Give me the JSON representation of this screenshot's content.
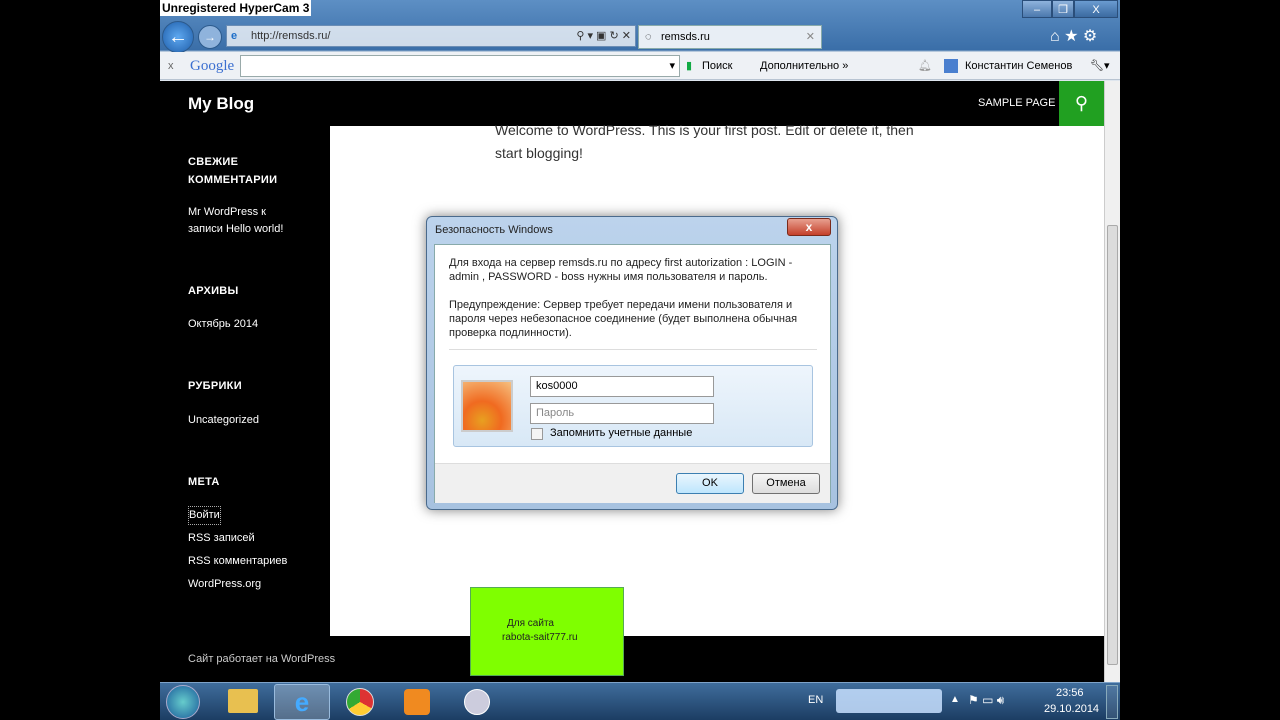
{
  "recorder_watermark": "Unregistered HyperCam 3",
  "browser": {
    "address": "http://remsds.ru/",
    "tab_title": "remsds.ru",
    "window_buttons": [
      "–",
      "❐",
      "X"
    ],
    "google_toolbar": {
      "logo": "Google",
      "search_value": "",
      "search_label": "Поиск",
      "more_label": "Дополнительно »",
      "user": "Константин Семенов"
    }
  },
  "site": {
    "title": "My Blog",
    "nav": [
      "SAMPLE PAGE"
    ],
    "search_color": "#21a021",
    "post_text_1": "Welcome to WordPress. This is your first post. Edit or delete it, then",
    "post_text_2": "start blogging!",
    "sidebar": {
      "recent_comments_title_1": "СВЕЖИЕ",
      "recent_comments_title_2": "КОММЕНТАРИИ",
      "comment_1": "Mr WordPress к",
      "comment_2": "записи Hello world!",
      "archives_title": "АРХИВЫ",
      "archive_item": "Октябрь 2014",
      "categories_title": "РУБРИКИ",
      "category_item": "Uncategorized",
      "meta_title": "МЕТА",
      "meta_items": [
        "Войти",
        "RSS записей",
        "RSS комментариев",
        "WordPress.org"
      ]
    },
    "footer": "Сайт работает на WordPress",
    "ad": {
      "line1": "Для сайта",
      "line2": "rabota-sait777.ru",
      "color": "#7fff00"
    }
  },
  "dialog": {
    "title": "Безопасность Windows",
    "message_1": "Для входа на сервер remsds.ru по адресу  first autorization : LOGIN -",
    "message_2": "admin , PASSWORD - boss нужны имя пользователя и пароль.",
    "warning_1": "Предупреждение: Сервер требует передачи имени пользователя и",
    "warning_2": "пароля через небезопасное соединение (будет выполнена обычная",
    "warning_3": "проверка подлинности).",
    "username_value": "kos0000",
    "password_placeholder": "Пароль",
    "remember_label": "Запомнить учетные данные",
    "remember_checked": false,
    "ok": "OK",
    "cancel": "Отмена"
  },
  "taskbar": {
    "lang": "EN",
    "time": "23:56",
    "date": "29.10.2014"
  }
}
